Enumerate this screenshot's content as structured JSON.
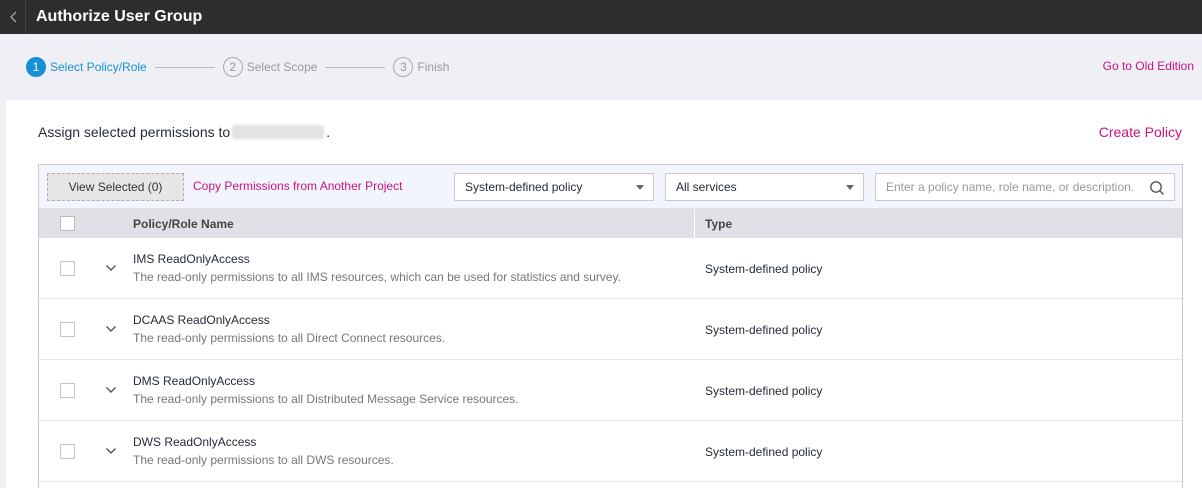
{
  "header": {
    "title": "Authorize User Group"
  },
  "steps": [
    {
      "num": "1",
      "label": "Select Policy/Role",
      "active": true
    },
    {
      "num": "2",
      "label": "Select Scope",
      "active": false
    },
    {
      "num": "3",
      "label": "Finish",
      "active": false
    }
  ],
  "links": {
    "old_edition": "Go to Old Edition",
    "create_policy": "Create Policy"
  },
  "assign": {
    "prefix": "Assign selected permissions to",
    "suffix": "."
  },
  "toolbar": {
    "view_selected": "View Selected (0)",
    "copy_permissions": "Copy Permissions from Another Project",
    "policy_filter": "System-defined policy",
    "service_filter": "All services",
    "search_placeholder": "Enter a policy name, role name, or description."
  },
  "table": {
    "columns": {
      "name": "Policy/Role Name",
      "type": "Type"
    },
    "rows": [
      {
        "name": "IMS ReadOnlyAccess",
        "description": "The read-only permissions to all IMS resources, which can be used for statistics and survey.",
        "type": "System-defined policy"
      },
      {
        "name": "DCAAS ReadOnlyAccess",
        "description": "The read-only permissions to all Direct Connect resources.",
        "type": "System-defined policy"
      },
      {
        "name": "DMS ReadOnlyAccess",
        "description": "The read-only permissions to all Distributed Message Service resources.",
        "type": "System-defined policy"
      },
      {
        "name": "DWS ReadOnlyAccess",
        "description": "The read-only permissions to all DWS resources.",
        "type": "System-defined policy"
      }
    ]
  },
  "colors": {
    "accent_blue": "#1890d5",
    "link_magenta": "#c7147e",
    "topbar": "#2d2d2d"
  }
}
